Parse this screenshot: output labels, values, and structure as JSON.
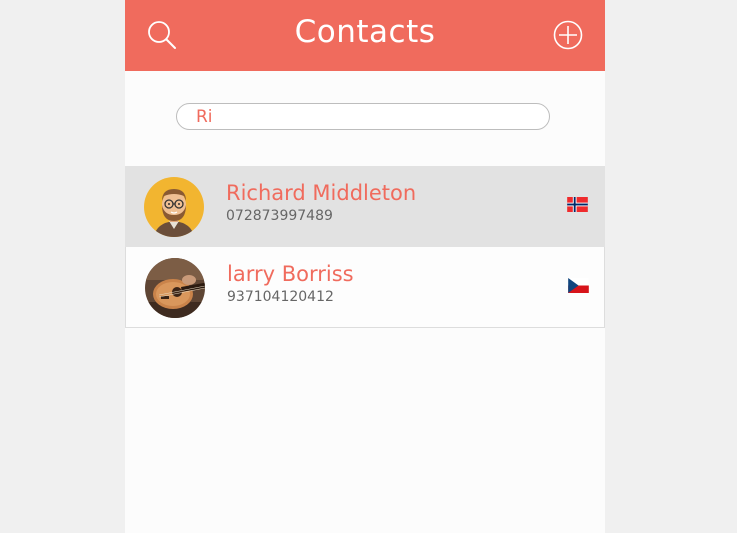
{
  "header": {
    "title": "Contacts",
    "search_icon": "search-icon",
    "add_icon": "plus-circle-icon",
    "background_color": "#f06b5d"
  },
  "search": {
    "value": "Ri",
    "placeholder": ""
  },
  "contacts": [
    {
      "name": "Richard Middleton",
      "phone": "072873997489",
      "flag": "norway-flag-icon",
      "avatar": "cartoon-man-avatar",
      "selected": true
    },
    {
      "name": "larry Borriss",
      "phone": "937104120412",
      "flag": "czech-flag-icon",
      "avatar": "guitar-photo-avatar",
      "selected": false
    }
  ]
}
